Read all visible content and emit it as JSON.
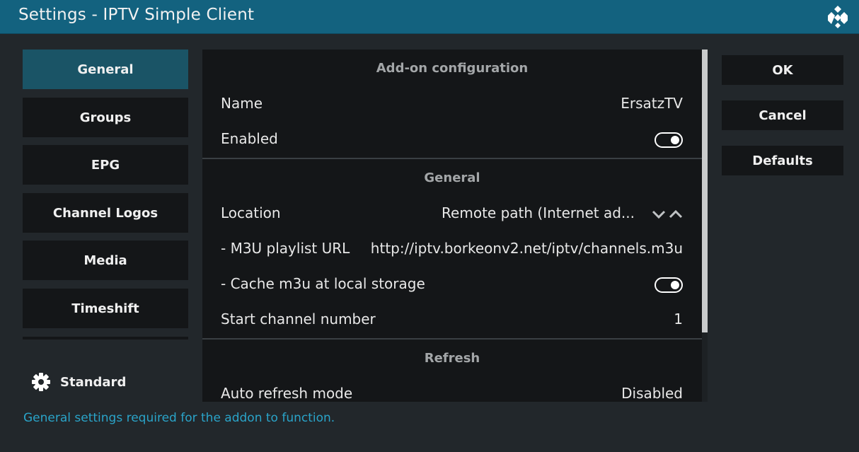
{
  "window": {
    "title": "Settings - IPTV Simple Client",
    "logo_icon": "kodi-logo-icon",
    "accent_color": "#13627f"
  },
  "categories": [
    {
      "label": "General",
      "active": true
    },
    {
      "label": "Groups",
      "active": false
    },
    {
      "label": "EPG",
      "active": false
    },
    {
      "label": "Channel Logos",
      "active": false
    },
    {
      "label": "Media",
      "active": false
    },
    {
      "label": "Timeshift",
      "active": false
    }
  ],
  "settings_level": {
    "icon": "gear-icon",
    "label": "Standard"
  },
  "sections": {
    "addon_config": {
      "header": "Add-on configuration",
      "name": {
        "label": "Name",
        "value": "ErsatzTV"
      },
      "enabled": {
        "label": "Enabled",
        "on": true
      }
    },
    "general": {
      "header": "General",
      "location": {
        "label": "Location",
        "value": "Remote path (Internet ad..."
      },
      "m3u_url": {
        "label": "- M3U playlist URL",
        "value": "http://iptv.borkeonv2.net/iptv/channels.m3u"
      },
      "cache_m3u": {
        "label": "- Cache m3u at local storage",
        "on": true
      },
      "start_channel": {
        "label": "Start channel number",
        "value": "1"
      }
    },
    "refresh": {
      "header": "Refresh",
      "auto_refresh": {
        "label": "Auto refresh mode",
        "value": "Disabled"
      }
    }
  },
  "buttons": {
    "ok": "OK",
    "cancel": "Cancel",
    "defaults": "Defaults"
  },
  "footer": {
    "description": "General settings required for the addon to function.",
    "color": "#2aa4c9"
  }
}
